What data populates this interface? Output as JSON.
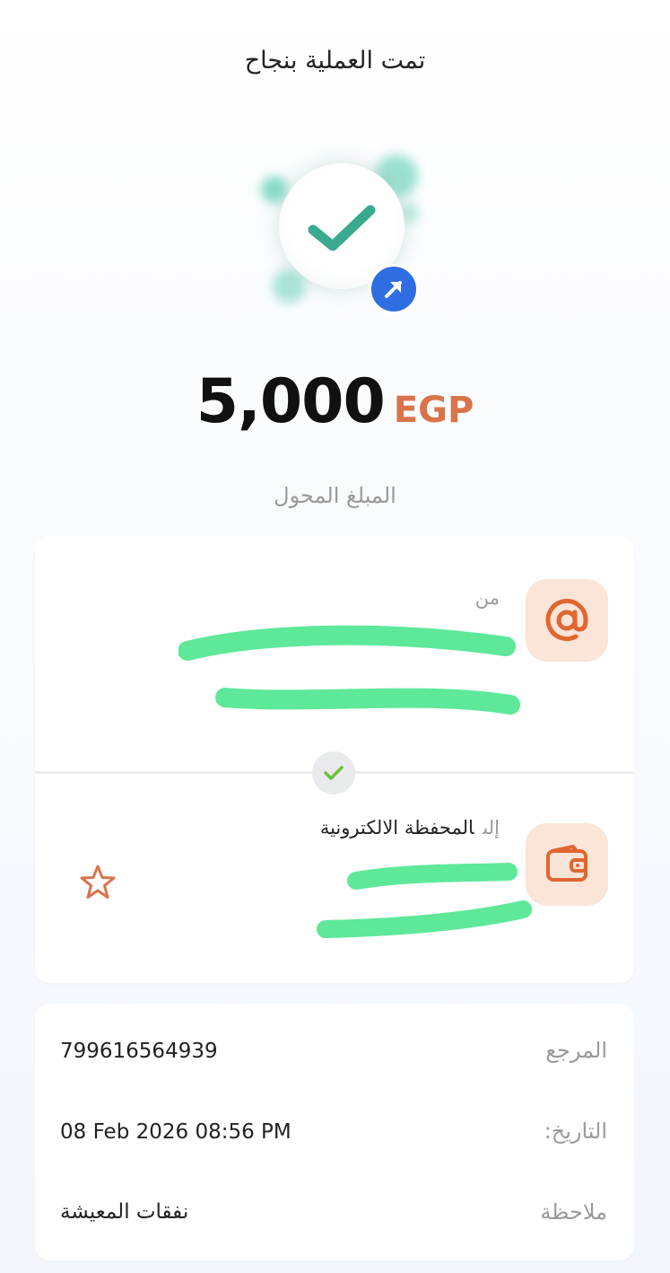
{
  "header": {
    "title": "تمت العملية بنجاح"
  },
  "transfer": {
    "amount": "5,000",
    "currency": "EGP",
    "amount_label": "المبلغ المحول"
  },
  "from": {
    "label": "من",
    "icon": "at-sign-icon"
  },
  "to": {
    "label": "إلى",
    "destination": "المحفظة الالكترونية",
    "icon": "wallet-icon",
    "favorite_icon": "star-icon"
  },
  "details": {
    "reference_label": "المرجع",
    "reference_value": "799616564939",
    "date_label": "التاريخ:",
    "date_value": "08 Feb 2026 08:56 PM",
    "note_label": "ملاحظة",
    "note_value": "نفقات المعيشة"
  },
  "colors": {
    "accent": "#d9744a",
    "success": "#3aaa8f",
    "badge": "#2f6de2",
    "redaction": "#5ee89a"
  }
}
